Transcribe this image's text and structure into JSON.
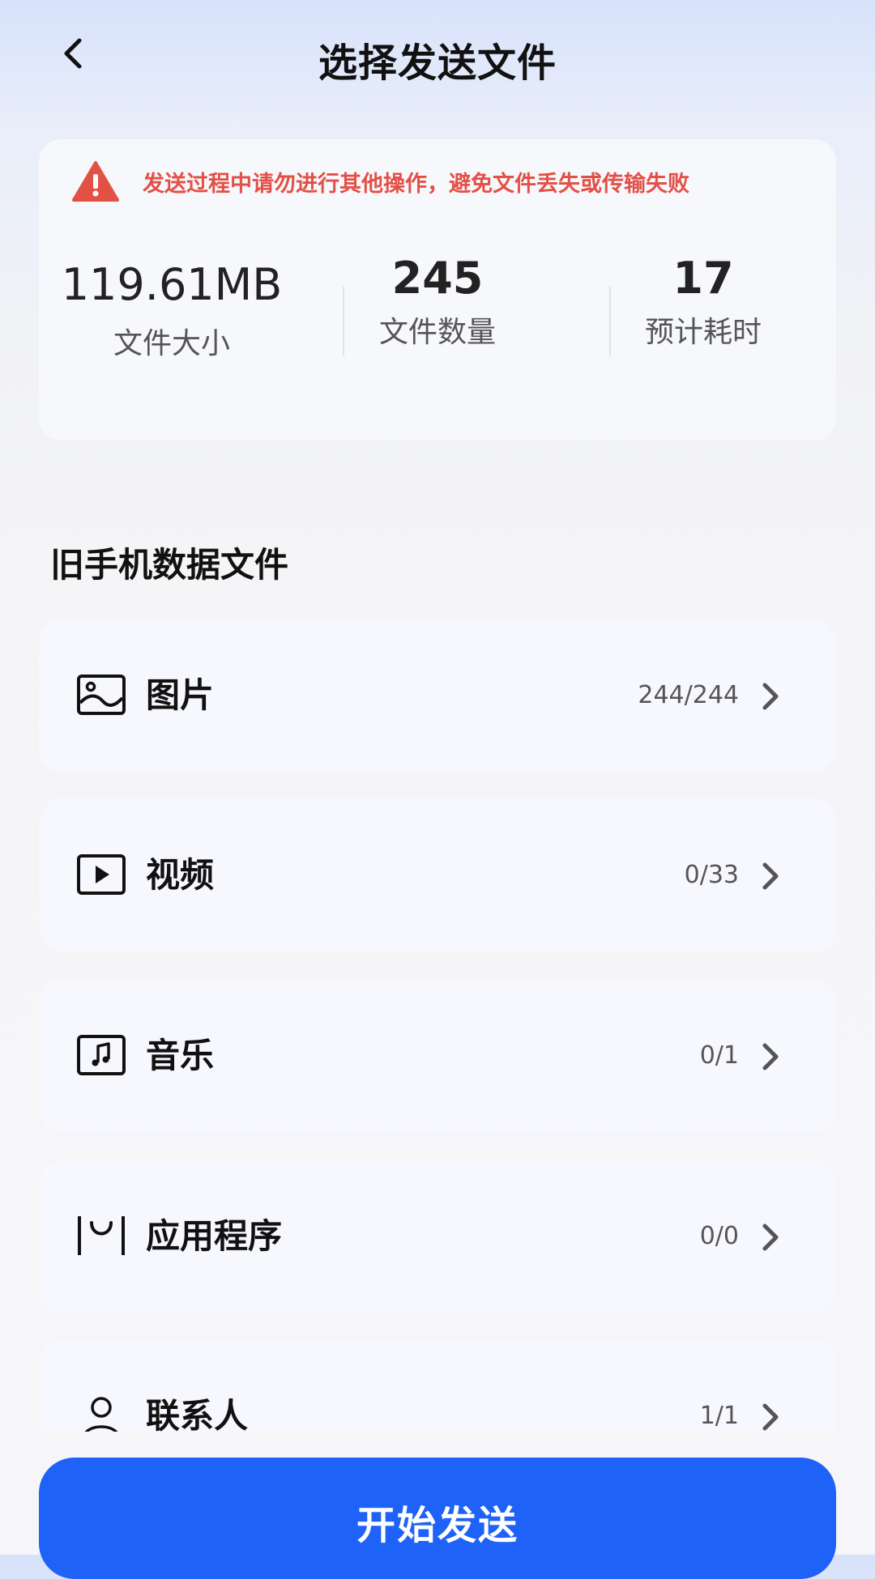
{
  "header": {
    "title": "选择发送文件",
    "back_icon": "back-arrow-icon"
  },
  "warning": {
    "icon": "warning-icon",
    "text": "发送过程中请勿进行其他操作，避免文件丢失或传输失败",
    "color": "#e35046"
  },
  "stats": [
    {
      "value": "119.61MB",
      "label": "文件大小"
    },
    {
      "value": "245",
      "label": "文件数量"
    },
    {
      "value": "17",
      "label": "预计耗时"
    }
  ],
  "section": {
    "title": "旧手机数据文件"
  },
  "items": [
    {
      "icon": "image-icon",
      "name": "图片",
      "count": "244/244"
    },
    {
      "icon": "video-icon",
      "name": "视频",
      "count": "0/33"
    },
    {
      "icon": "music-icon",
      "name": "音乐",
      "count": "0/1"
    },
    {
      "icon": "app-icon",
      "name": "应用程序",
      "count": "0/0"
    },
    {
      "icon": "contact-icon",
      "name": "联系人",
      "count": "1/1"
    }
  ],
  "start_button": {
    "label": "开始发送",
    "color": "#1f62f8"
  }
}
